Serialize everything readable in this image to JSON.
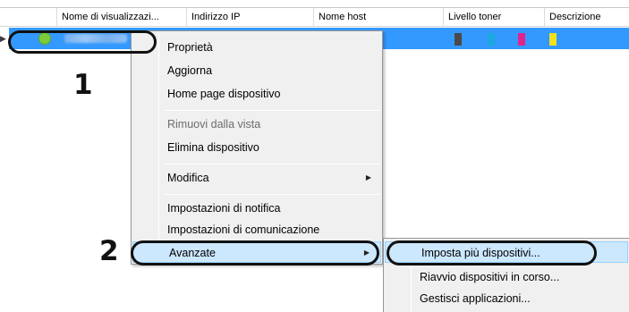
{
  "grid": {
    "columns": [
      {
        "label": ""
      },
      {
        "label": "Nome di visualizzazi..."
      },
      {
        "label": "Indirizzo IP"
      },
      {
        "label": "Nome host"
      },
      {
        "label": "Livello toner"
      },
      {
        "label": "Descrizione"
      }
    ],
    "row": {
      "status_color": "#7ccc3a",
      "toner_colors": [
        "#4a4a4a",
        "#1ba7e0",
        "#e0248c",
        "#f2e11c"
      ]
    }
  },
  "context_menu": {
    "items": [
      {
        "label": "Proprietà",
        "disabled": false
      },
      {
        "label": "Aggiorna",
        "disabled": false
      },
      {
        "label": "Home page dispositivo",
        "disabled": false
      },
      {
        "label": "Rimuovi dalla vista",
        "disabled": true
      },
      {
        "label": "Elimina dispositivo",
        "disabled": false
      },
      {
        "label": "Modifica",
        "disabled": false,
        "submenu": true
      },
      {
        "label": "Impostazioni di notifica",
        "disabled": false
      },
      {
        "label": "Impostazioni di comunicazione",
        "disabled": false
      },
      {
        "label": "Avanzate",
        "disabled": false,
        "submenu": true,
        "highlighted": true
      }
    ]
  },
  "submenu": {
    "items": [
      {
        "label": "Imposta più dispositivi...",
        "highlighted": true
      },
      {
        "label": "Riavvio dispositivi in corso..."
      },
      {
        "label": "Gestisci applicazioni..."
      }
    ]
  },
  "callouts": {
    "step1": "1",
    "step2": "2"
  },
  "colors": {
    "selection": "#3399ff",
    "menu_background": "#f0f0f0",
    "menu_highlight": "#cce8ff"
  }
}
